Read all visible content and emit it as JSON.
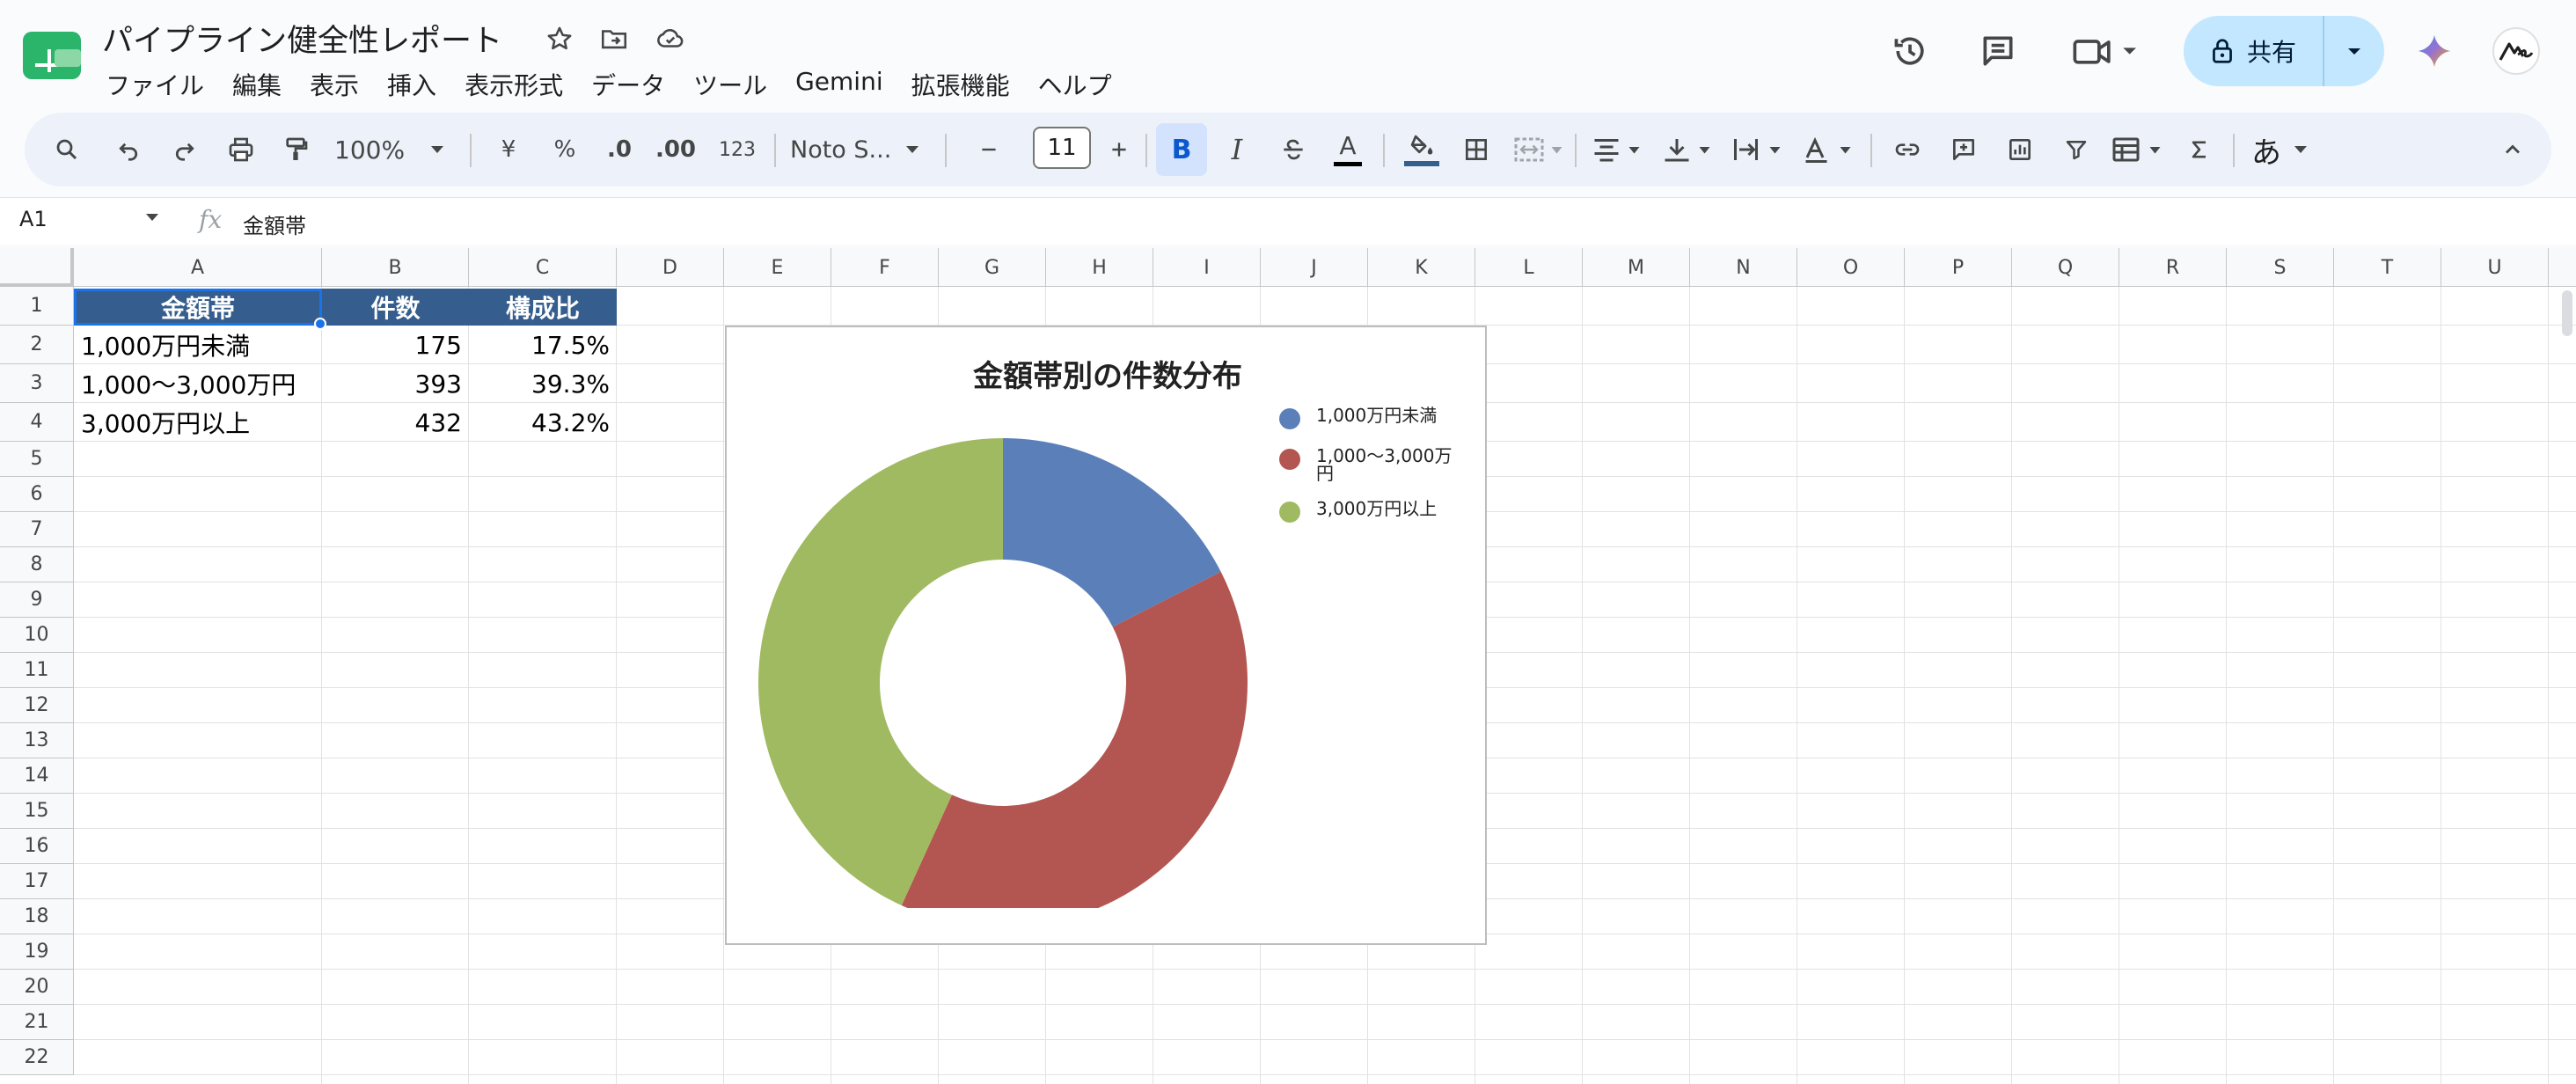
{
  "doc": {
    "title": "パイプライン健全性レポート"
  },
  "menu": [
    "ファイル",
    "編集",
    "表示",
    "挿入",
    "表示形式",
    "データ",
    "ツール",
    "Gemini",
    "拡張機能",
    "ヘルプ"
  ],
  "share": {
    "label": "共有"
  },
  "toolbar": {
    "zoom": "100%",
    "currency": "¥",
    "percent": "%",
    "dec_decrease": ".0",
    "dec_increase": ".00",
    "number_format": "123",
    "font": "Noto S...",
    "font_size": "11",
    "bold": "B",
    "italic": "I",
    "text_color": "A",
    "ime": "あ"
  },
  "formula_bar": {
    "name_box": "A1",
    "content": "金額帯"
  },
  "columns": [
    "A",
    "B",
    "C",
    "D",
    "E",
    "F",
    "G",
    "H",
    "I",
    "J",
    "K",
    "L",
    "M",
    "N",
    "O",
    "P",
    "Q",
    "R",
    "S",
    "T",
    "U"
  ],
  "rows": [
    "1",
    "2",
    "3",
    "4",
    "5",
    "6",
    "7",
    "8",
    "9",
    "10",
    "11",
    "12",
    "13",
    "14",
    "15",
    "16",
    "17",
    "18",
    "19",
    "20",
    "21",
    "22"
  ],
  "table": {
    "headers": [
      "金額帯",
      "件数",
      "構成比"
    ],
    "rows": [
      [
        "1,000万円未満",
        "175",
        "17.5%"
      ],
      [
        "1,000〜3,000万円",
        "393",
        "39.3%"
      ],
      [
        "3,000万円以上",
        "432",
        "43.2%"
      ]
    ]
  },
  "colors": {
    "accent": "#1a73e8",
    "header_fill": "#355e8e",
    "share_bg": "#c2e7ff"
  },
  "chart_data": {
    "type": "pie",
    "style": "donut",
    "title": "金額帯別の件数分布",
    "categories": [
      "1,000万円未満",
      "1,000〜3,000万円",
      "3,000万円以上"
    ],
    "values": [
      175,
      393,
      432
    ],
    "colors": [
      "#5b80b9",
      "#b35651",
      "#a0ba61"
    ],
    "legend": "right",
    "legend_labels": [
      [
        "1,000万円未満"
      ],
      [
        "1,000〜3,000万",
        "円"
      ],
      [
        "3,000万円以上"
      ]
    ]
  }
}
